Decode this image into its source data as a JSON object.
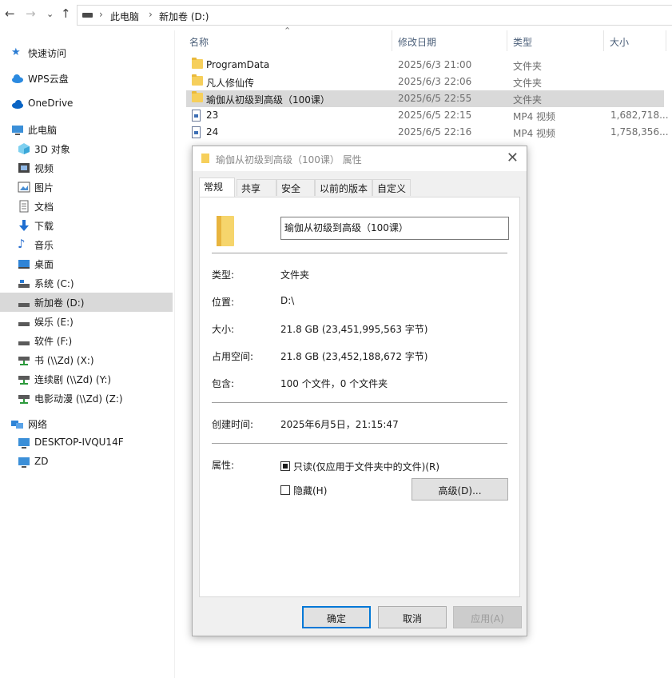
{
  "address": {
    "crumbs": [
      "此电脑",
      "新加卷 (D:)"
    ]
  },
  "sidebar": {
    "items": [
      {
        "label": "快速访问",
        "icon": "star-icon"
      },
      {
        "label": "WPS云盘",
        "icon": "cloud-icon"
      },
      {
        "label": "OneDrive",
        "icon": "cloud-icon"
      },
      {
        "label": "此电脑",
        "icon": "computer-icon"
      },
      {
        "label": "3D 对象",
        "icon": "cube-icon"
      },
      {
        "label": "视频",
        "icon": "video-icon"
      },
      {
        "label": "图片",
        "icon": "picture-icon"
      },
      {
        "label": "文档",
        "icon": "document-icon"
      },
      {
        "label": "下载",
        "icon": "download-icon"
      },
      {
        "label": "音乐",
        "icon": "music-icon"
      },
      {
        "label": "桌面",
        "icon": "desktop-icon"
      },
      {
        "label": "系统 (C:)",
        "icon": "drive-icon"
      },
      {
        "label": "新加卷 (D:)",
        "icon": "drive-icon"
      },
      {
        "label": "娱乐 (E:)",
        "icon": "drive-icon"
      },
      {
        "label": "软件 (F:)",
        "icon": "drive-icon"
      },
      {
        "label": "书 (\\\\Zd) (X:)",
        "icon": "network-drive-icon"
      },
      {
        "label": "连续剧 (\\\\Zd) (Y:)",
        "icon": "network-drive-icon"
      },
      {
        "label": "电影动漫 (\\\\Zd) (Z:)",
        "icon": "network-drive-icon"
      },
      {
        "label": "网络",
        "icon": "network-icon"
      },
      {
        "label": "DESKTOP-IVQU14F",
        "icon": "monitor-icon"
      },
      {
        "label": "ZD",
        "icon": "monitor-icon"
      }
    ]
  },
  "columns": {
    "name": "名称",
    "date": "修改日期",
    "type": "类型",
    "size": "大小"
  },
  "files": [
    {
      "name": "ProgramData",
      "date": "2025/6/3 21:00",
      "type": "文件夹",
      "size": "",
      "kind": "folder"
    },
    {
      "name": "凡人修仙传",
      "date": "2025/6/3 22:06",
      "type": "文件夹",
      "size": "",
      "kind": "folder"
    },
    {
      "name": "瑜伽从初级到高级（100课）",
      "date": "2025/6/5 22:55",
      "type": "文件夹",
      "size": "",
      "kind": "folder"
    },
    {
      "name": "23",
      "date": "2025/6/5 22:15",
      "type": "MP4 视频",
      "size": "1,682,718...",
      "kind": "video"
    },
    {
      "name": "24",
      "date": "2025/6/5 22:16",
      "type": "MP4 视频",
      "size": "1,758,356...",
      "kind": "video"
    }
  ],
  "dialog": {
    "title": "瑜伽从初级到高级（100课） 属性",
    "tabs": [
      "常规",
      "共享",
      "安全",
      "以前的版本",
      "自定义"
    ],
    "name_value": "瑜伽从初级到高级（100课）",
    "props": {
      "type_k": "类型:",
      "type_v": "文件夹",
      "loc_k": "位置:",
      "loc_v": "D:\\",
      "size_k": "大小:",
      "size_v": "21.8 GB (23,451,995,563 字节)",
      "disk_k": "占用空间:",
      "disk_v": "21.8 GB (23,452,188,672 字节)",
      "contains_k": "包含:",
      "contains_v": "100 个文件，0 个文件夹",
      "created_k": "创建时间:",
      "created_v": "2025年6月5日，21:15:47",
      "attr_k": "属性:"
    },
    "readonly_label": "只读(仅应用于文件夹中的文件)(R)",
    "readonly_checked": true,
    "hidden_label": "隐藏(H)",
    "hidden_checked": false,
    "advanced_label": "高级(D)...",
    "ok_label": "确定",
    "cancel_label": "取消",
    "apply_label": "应用(A)"
  },
  "colors": {
    "selection": "#d9d9d9",
    "folder": "#f6cf5b",
    "accent": "#0078d7"
  }
}
